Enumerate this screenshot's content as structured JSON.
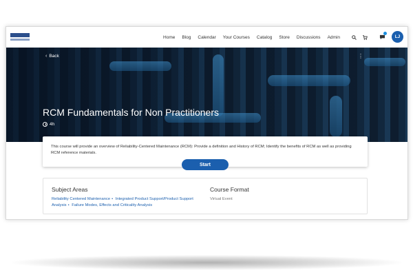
{
  "nav": {
    "links": [
      "Home",
      "Blog",
      "Calendar",
      "Your Courses",
      "Catalog",
      "Store",
      "Discussions",
      "Admin"
    ],
    "avatar_initials": "LJ"
  },
  "hero": {
    "back_label": "Back",
    "title": "RCM Fundamentals for Non Practitioners",
    "duration": "4h"
  },
  "description": "This course will provide an overview of Reliability-Centered Maintenance (RCM): Provide a definition and History of RCM; Identify the benefits of RCM as well as providing RCM reference materials.",
  "start_label": "Start",
  "info": {
    "subject_title": "Subject Areas",
    "subjects": [
      "Reliability Centered Maintenance",
      "Integrated Product Support/Product Support Analysis",
      "Failure Modes, Effects and Criticality Analysis"
    ],
    "format_title": "Course Format",
    "format_value": "Virtual Event"
  },
  "colors": {
    "accent": "#1b5fae"
  }
}
